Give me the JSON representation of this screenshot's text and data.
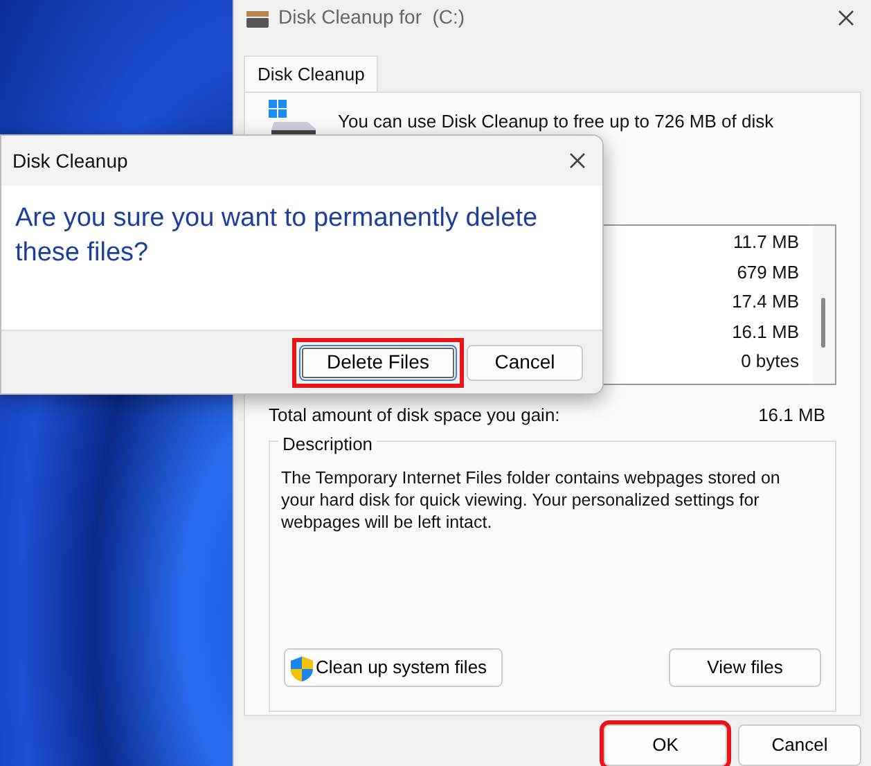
{
  "main_window": {
    "title": "Disk Cleanup for  (C:)",
    "tabs": [
      {
        "label": "Disk Cleanup",
        "selected": true
      }
    ],
    "intro": "You can use Disk Cleanup to free up to 726 MB of disk",
    "file_list": [
      {
        "size": "11.7 MB"
      },
      {
        "size": "679 MB"
      },
      {
        "size": "17.4 MB"
      },
      {
        "size": "16.1 MB"
      },
      {
        "size": "0 bytes"
      }
    ],
    "total_label": "Total amount of disk space you gain:",
    "total_value": "16.1 MB",
    "description": {
      "title": "Description",
      "text": "The Temporary Internet Files folder contains webpages stored on your hard disk for quick viewing. Your personalized settings for webpages will be left intact."
    },
    "panel_buttons": [
      {
        "label": "Clean up system files",
        "kind": "shield"
      },
      {
        "label": "View files",
        "kind": "plain"
      }
    ],
    "buttons": [
      {
        "label": "OK",
        "highlighted": true
      },
      {
        "label": "Cancel",
        "highlighted": false
      }
    ]
  },
  "dialog": {
    "title": "Disk Cleanup",
    "message": "Are you sure you want to permanently delete these files?",
    "buttons": [
      {
        "label": "Delete Files",
        "highlighted": true,
        "focused": true
      },
      {
        "label": "Cancel",
        "highlighted": false,
        "focused": false
      }
    ]
  }
}
